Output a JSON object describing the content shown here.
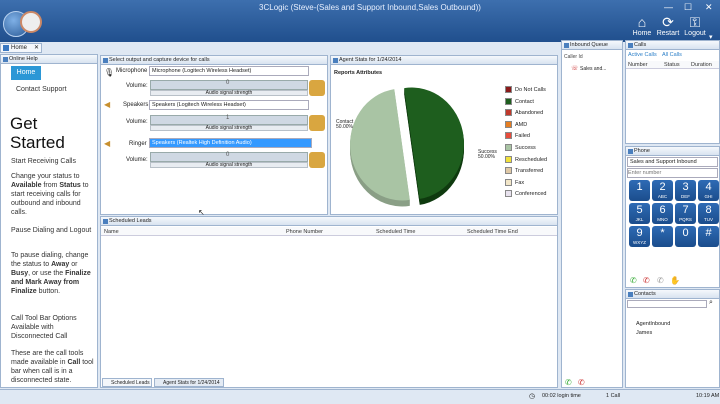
{
  "window": {
    "title": "3CLogic (Steve-(Sales and Support Inbound,Sales Outbound))"
  },
  "toolbar": {
    "home": "Home",
    "restart": "Restart",
    "logout": "Logout"
  },
  "tab": {
    "home": "Home"
  },
  "help": {
    "header": "Online Help",
    "home_button": "Home",
    "contact_support": "Contact Support",
    "get_started_1": "Get",
    "get_started_2": "Started",
    "start_receiving": "Start Receiving Calls",
    "p1a": "Change your status to",
    "p1b": "Available",
    "p1c": " from ",
    "p1d": "Status",
    "p1e": "to start receiving calls for outbound and inbound calls.",
    "pause_dialing": "Pause Dialing and Logout",
    "p2": "To pause dialing, change the status to",
    "p2b": "Away",
    "p2c": " or ",
    "p2d": "Busy",
    "p2e": ", or use the ",
    "p2f": "Finalize and Mark Away from Finalize",
    "p2g": " button.",
    "calltool": "Call Tool Bar Options Available with Disconnected Call",
    "p3": "These are the call tools made available in",
    "p3b": "Call",
    "p3c": "tool bar when call is in a disconnected state."
  },
  "devices": {
    "header": "Select output and capture device for calls",
    "microphone": {
      "label": "Microphone",
      "value": "Microphone (Logitech Wireless Headset)",
      "volume_label": "Volume:",
      "volume": 0,
      "signal": "Audio signal strength"
    },
    "speakers": {
      "label": "Speakers",
      "value": "Speakers (Logitech Wireless Headset)",
      "volume_label": "Volume:",
      "volume": 1,
      "signal": "Audio signal strength"
    },
    "ringer": {
      "label": "Ringer",
      "value": "Speakers (Realtek High Definition Audio)",
      "volume_label": "Volume:",
      "volume": 0,
      "signal": "Audio signal strength"
    }
  },
  "agent_stats": {
    "header": "Agent Stats for 1/24/2014",
    "subtitle": "Reports Attributes",
    "contact_label": "Contact",
    "contact_pct": "50.00%",
    "success_label": "Success",
    "success_pct": "50.00%",
    "legend": [
      {
        "label": "Do Not Calls",
        "color": "#8b1a1a"
      },
      {
        "label": "Contact",
        "color": "#1e5e1e"
      },
      {
        "label": "Abandoned",
        "color": "#c0392b"
      },
      {
        "label": "AMD",
        "color": "#e67e22"
      },
      {
        "label": "Failed",
        "color": "#e74c3c"
      },
      {
        "label": "Success",
        "color": "#a9c4a4"
      },
      {
        "label": "Rescheduled",
        "color": "#f1e13b"
      },
      {
        "label": "Transferred",
        "color": "#e0c9a6"
      },
      {
        "label": "Fax",
        "color": "#f2e6c8"
      },
      {
        "label": "Conferenced",
        "color": "#e8e2ee"
      }
    ]
  },
  "chart_data": {
    "type": "pie",
    "title": "Reports Attributes",
    "categories": [
      "Contact",
      "Success"
    ],
    "values": [
      50,
      50
    ]
  },
  "scheduled": {
    "header": "Scheduled Leads",
    "columns": [
      "Name",
      "Phone Number",
      "Scheduled Time",
      "Scheduled Time End"
    ],
    "tab_scheduled": "Scheduled Leads",
    "tab_agent": "Agent Stats for 1/24/2014"
  },
  "inbound": {
    "header": "Inbound Queue",
    "caller_id": "Caller Id",
    "item": "Sales and..."
  },
  "calls": {
    "header": "Calls",
    "tab_active": "Active Calls",
    "tab_all": "All Calls",
    "columns": [
      "Number",
      "Status",
      "Duration"
    ]
  },
  "phone": {
    "header": "Phone",
    "queue": "Sales and Support Inbound",
    "placeholder": "Enter number",
    "keys": [
      {
        "d": "1",
        "l": ""
      },
      {
        "d": "2",
        "l": "ABC"
      },
      {
        "d": "3",
        "l": "DEF"
      },
      {
        "d": "4",
        "l": "GHI"
      },
      {
        "d": "5",
        "l": "JKL"
      },
      {
        "d": "6",
        "l": "MNO"
      },
      {
        "d": "7",
        "l": "PQRS"
      },
      {
        "d": "8",
        "l": "TUV"
      },
      {
        "d": "9",
        "l": "WXYZ"
      },
      {
        "d": "*",
        "l": ""
      },
      {
        "d": "0",
        "l": ""
      },
      {
        "d": "#",
        "l": ""
      }
    ]
  },
  "contacts": {
    "header": "Contacts",
    "items": [
      "AgentInbound",
      "James"
    ]
  },
  "status": {
    "login_time": "00:02 login time",
    "calls": "1 Call",
    "clock": "10:19 AM"
  }
}
